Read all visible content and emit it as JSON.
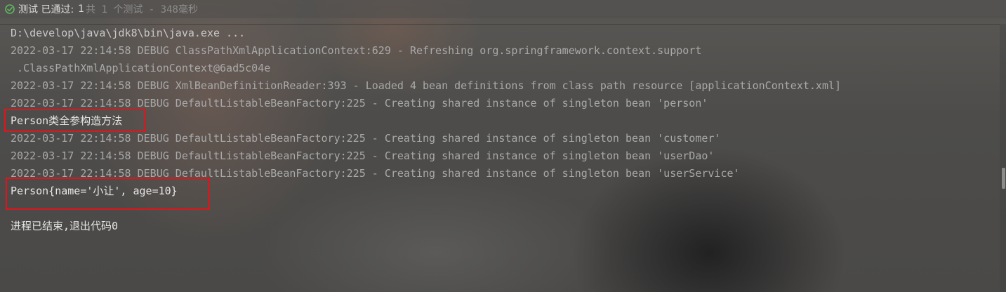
{
  "test_status": {
    "icon": "check-circle-icon",
    "passed_label": "测试 已通过:",
    "passed_count": "1",
    "summary": "共 1 个测试 - 348毫秒",
    "icon_color": "#5fb85f"
  },
  "console": {
    "lines": [
      "D:\\develop\\java\\jdk8\\bin\\java.exe ...",
      "2022-03-17 22:14:58 DEBUG ClassPathXmlApplicationContext:629 - Refreshing org.springframework.context.support",
      " .ClassPathXmlApplicationContext@6ad5c04e",
      "2022-03-17 22:14:58 DEBUG XmlBeanDefinitionReader:393 - Loaded 4 bean definitions from class path resource [applicationContext.xml]",
      "2022-03-17 22:14:58 DEBUG DefaultListableBeanFactory:225 - Creating shared instance of singleton bean 'person'",
      "Person类全参构造方法",
      "2022-03-17 22:14:58 DEBUG DefaultListableBeanFactory:225 - Creating shared instance of singleton bean 'customer'",
      "2022-03-17 22:14:58 DEBUG DefaultListableBeanFactory:225 - Creating shared instance of singleton bean 'userDao'",
      "2022-03-17 22:14:58 DEBUG DefaultListableBeanFactory:225 - Creating shared instance of singleton bean 'userService'",
      "Person{name='小让', age=10}",
      "进程已结束,退出代码0"
    ]
  },
  "colors": {
    "highlight_border": "#e0151b",
    "text_output": "#e6e6e6",
    "text_debug": "#a9a9a9"
  }
}
